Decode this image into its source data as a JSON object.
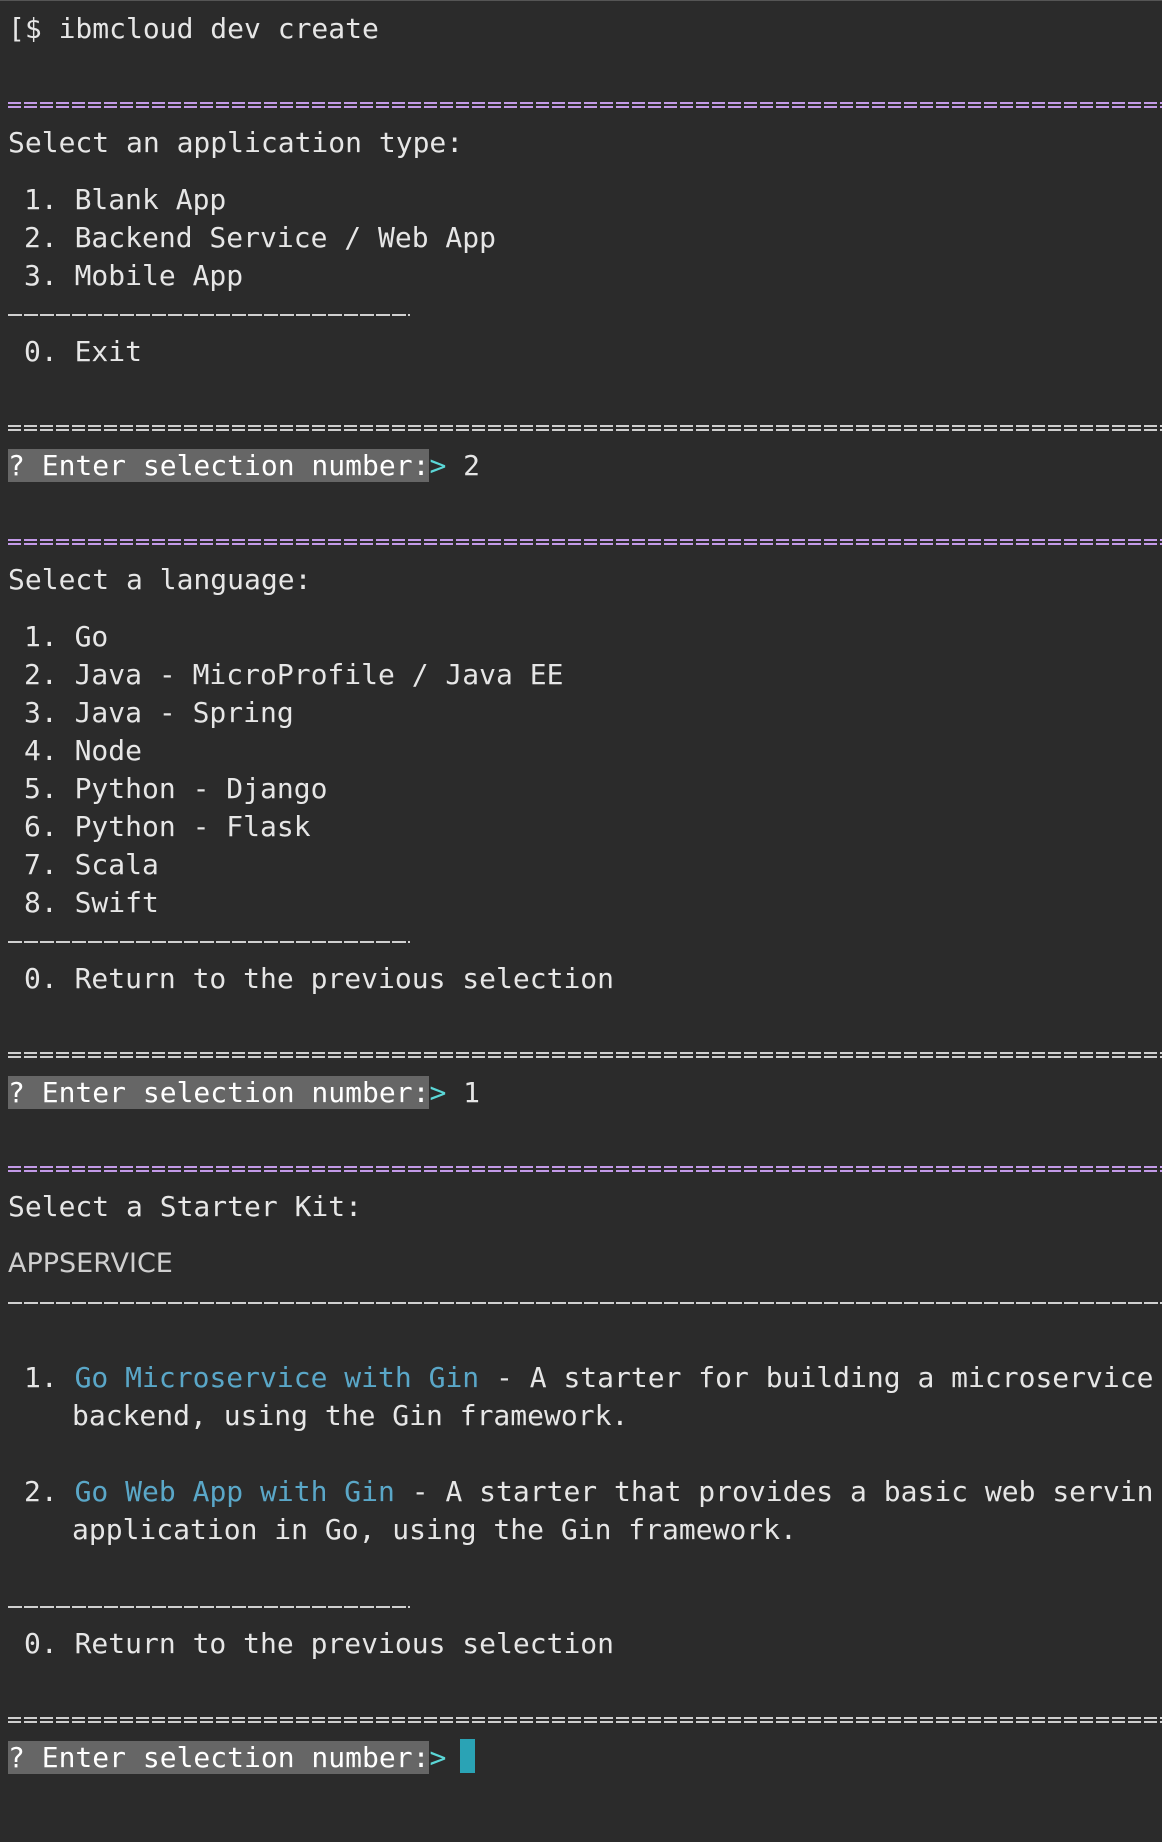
{
  "terminal": {
    "command": "[$ ibmcloud dev create",
    "prompt_label": "? Enter selection number:",
    "prompt_caret": ">",
    "app_type": {
      "heading": "Select an application type:",
      "options": [
        "1. Blank App",
        "2. Backend Service / Web App",
        "3. Mobile App"
      ],
      "exit": "0. Exit",
      "answer": " 2"
    },
    "language": {
      "heading": "Select a language:",
      "options": [
        "1. Go",
        "2. Java - MicroProfile / Java EE",
        "3. Java - Spring",
        "4. Node",
        "5. Python - Django",
        "6. Python - Flask",
        "7. Scala",
        "8. Swift"
      ],
      "back": "0. Return to the previous selection",
      "answer": " 1"
    },
    "starter_kit": {
      "heading": "Select a Starter Kit:",
      "category": "APPSERVICE",
      "kits": [
        {
          "number": "1. ",
          "name": "Go Microservice with Gin",
          "desc": " - A starter for building a microservice",
          "desc2": "backend, using the Gin framework."
        },
        {
          "number": "2. ",
          "name": "Go Web App with Gin",
          "desc": " - A starter that provides a basic web serving",
          "desc2": "application in Go, using the Gin framework."
        }
      ],
      "back": "0. Return to the previous selection"
    },
    "colors": {
      "background": "#2b2b2b",
      "rule_purple": "#c39ae8",
      "kit_name": "#5aa7c8",
      "caret": "#5bd7d7",
      "cursor": "#2aa3b5"
    }
  }
}
